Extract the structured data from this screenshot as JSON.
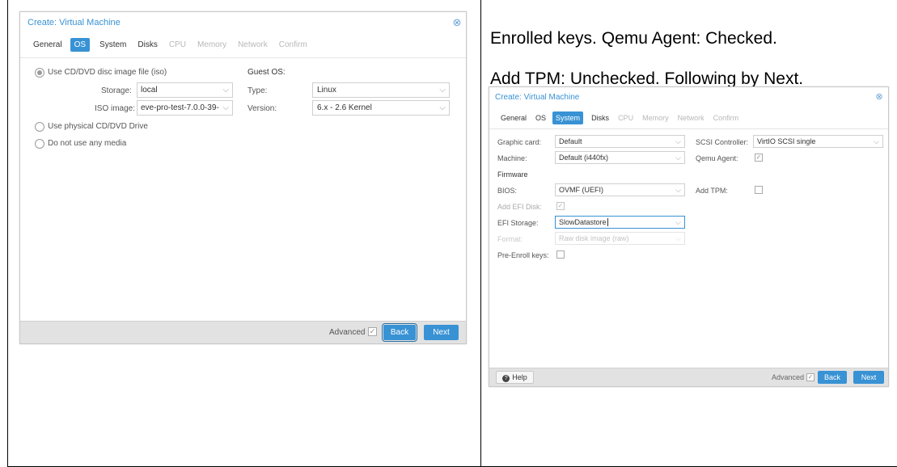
{
  "note": {
    "line1": "Enrolled keys. Qemu Agent: Checked.",
    "line2": "Add TPM: Unchecked. Following by Next."
  },
  "left_dialog": {
    "title": "Create: Virtual Machine",
    "tabs": [
      "General",
      "OS",
      "System",
      "Disks",
      "CPU",
      "Memory",
      "Network",
      "Confirm"
    ],
    "active_tab": "OS",
    "radio_iso": "Use CD/DVD disc image file (iso)",
    "storage_label": "Storage:",
    "storage_value": "local",
    "iso_label": "ISO image:",
    "iso_value": "eve-pro-test-7.0.0-39-",
    "guest_os_label": "Guest OS:",
    "type_label": "Type:",
    "type_value": "Linux",
    "version_label": "Version:",
    "version_value": "6.x - 2.6 Kernel",
    "radio_physical": "Use physical CD/DVD Drive",
    "radio_none": "Do not use any media",
    "advanced_label": "Advanced",
    "back_label": "Back",
    "next_label": "Next"
  },
  "right_dialog": {
    "title": "Create: Virtual Machine",
    "tabs": [
      "General",
      "OS",
      "System",
      "Disks",
      "CPU",
      "Memory",
      "Network",
      "Confirm"
    ],
    "active_tab": "System",
    "graphic_label": "Graphic card:",
    "graphic_value": "Default",
    "machine_label": "Machine:",
    "machine_value": "Default (i440fx)",
    "firmware_label": "Firmware",
    "bios_label": "BIOS:",
    "bios_value": "OVMF (UEFI)",
    "add_efi_label": "Add EFI Disk:",
    "efi_storage_label": "EFI Storage:",
    "efi_storage_value": "SlowDatastore",
    "format_label": "Format:",
    "format_value": "Raw disk image (raw)",
    "pre_enroll_label": "Pre-Enroll keys:",
    "scsi_label": "SCSI Controller:",
    "scsi_value": "VirtIO SCSI single",
    "qemu_label": "Qemu Agent:",
    "tpm_label": "Add TPM:",
    "help_label": "Help",
    "advanced_label": "Advanced",
    "back_label": "Back",
    "next_label": "Next"
  },
  "colors": {
    "accent": "#3892d4",
    "footer": "#e2e2e2"
  }
}
